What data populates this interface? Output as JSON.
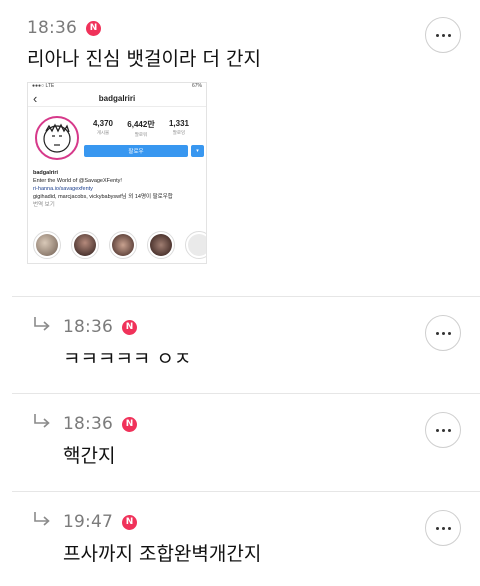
{
  "post": {
    "time": "18:36",
    "badge": "N",
    "text": "리아나 진심 뱃걸이라 더 간지",
    "more_icon": "more-horizontal-icon",
    "image": {
      "status_left": "●●●○ LTE",
      "status_right": "67%",
      "username": "badgalriri",
      "stats": [
        {
          "num": "4,370",
          "label": "게시물"
        },
        {
          "num": "6,442만",
          "label": "팔로워"
        },
        {
          "num": "1,331",
          "label": "팔로잉"
        }
      ],
      "follow_label": "팔로우",
      "bio_name": "badgalriri",
      "bio_line1": "Enter the World of @SavageXFenty!",
      "bio_line2": "ri-hanna.io/savagexfenty",
      "bio_line3": "gigihadid, marcjacobs, vickybabyswf님 외 14명이 팔로우합",
      "bio_line4": "번역 보기"
    }
  },
  "replies": [
    {
      "time": "18:36",
      "badge": "N",
      "text": "ㅋㅋㅋㅋㅋ ㅇㅈ"
    },
    {
      "time": "18:36",
      "badge": "N",
      "text": "핵간지"
    },
    {
      "time": "19:47",
      "badge": "N",
      "text": "프사까지 조합완벽개간지"
    }
  ],
  "colors": {
    "badge": "#f0325a",
    "follow": "#3897f0",
    "avatar_ring": "#d6398a"
  }
}
